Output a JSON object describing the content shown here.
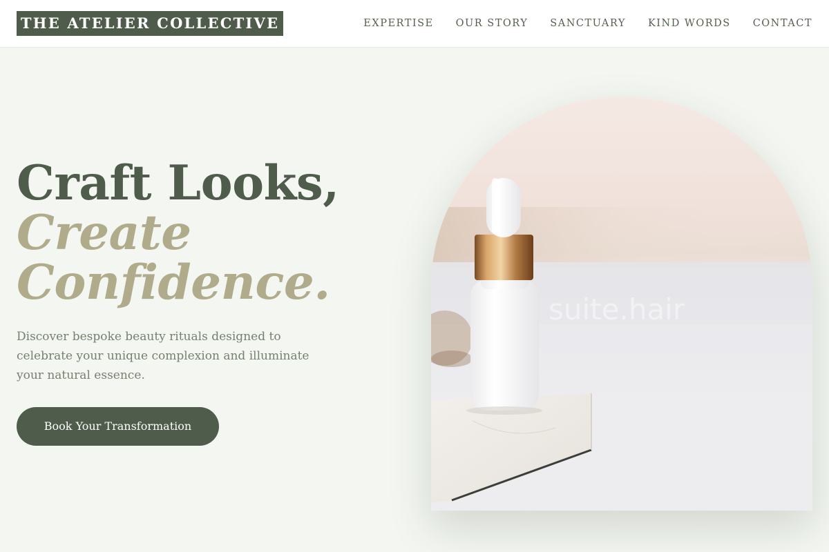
{
  "brand": {
    "name": "THE ATELIER COLLECTIVE"
  },
  "nav": {
    "items": [
      {
        "label": "EXPERTISE"
      },
      {
        "label": "OUR STORY"
      },
      {
        "label": "SANCTUARY"
      },
      {
        "label": "KIND WORDS"
      },
      {
        "label": "CONTACT"
      }
    ]
  },
  "hero": {
    "headline_line1": "Craft Looks,",
    "headline_line2": "Create",
    "headline_line3": "Confidence.",
    "description": "Discover bespoke beauty rituals designed to celebrate your unique complexion and illuminate your natural essence.",
    "cta_label": "Book Your Transformation",
    "image_watermark": "suite.hair",
    "image_subject": "white-dropper-bottle-on-marble-tray"
  },
  "colors": {
    "brand_green": "#4f5b4b",
    "accent_taupe": "#b0ab8b",
    "background": "#f3f6f1",
    "body_text": "#76806f"
  }
}
